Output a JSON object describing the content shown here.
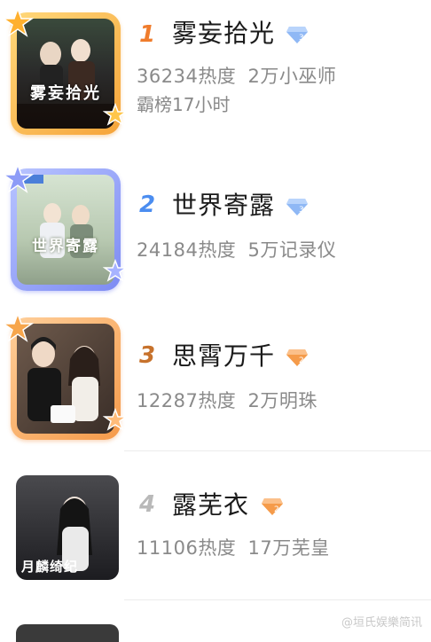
{
  "items": [
    {
      "rank": "1",
      "title": "雾妄拾光",
      "heat": "36234",
      "heat_label": "热度",
      "contrib": "2万小巫师",
      "sub": "霸榜17小时",
      "poster_text": "雾妄拾光",
      "tier": "diamond-blue"
    },
    {
      "rank": "2",
      "title": "世界寄露",
      "heat": "24184",
      "heat_label": "热度",
      "contrib": "5万记录仪",
      "poster_text": "世界寄露",
      "tier": "diamond-blue"
    },
    {
      "rank": "3",
      "title": "思霄万千",
      "heat": "12287",
      "heat_label": "热度",
      "contrib": "2万明珠",
      "tier": "diamond-orange"
    },
    {
      "rank": "4",
      "title": "露芜衣",
      "heat": "11106",
      "heat_label": "热度",
      "contrib": "17万芜皇",
      "poster_text": "月麟绮纪",
      "tier": "diamond-orange"
    }
  ],
  "watermark": "@垣氏娱樂简讯",
  "colors": {
    "rank1": "#f07c2c",
    "rank2": "#4b8df0",
    "rank3": "#c7722c",
    "rank4": "#b9b9b9",
    "text_main": "#1a1a1a",
    "text_sub": "#8a8a8a"
  }
}
